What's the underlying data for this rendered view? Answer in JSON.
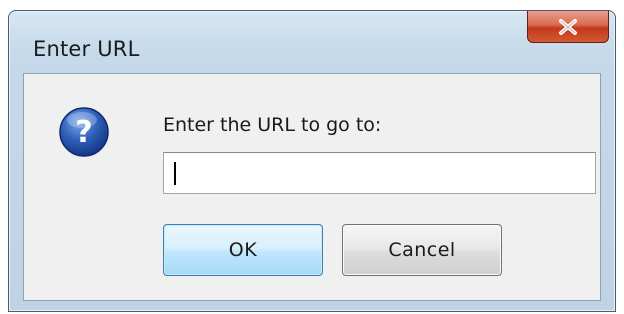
{
  "dialog": {
    "title": "Enter URL",
    "prompt": "Enter the URL to go to:",
    "url_value": "",
    "ok_label": "OK",
    "cancel_label": "Cancel"
  },
  "icons": {
    "close": "close-icon",
    "question": "question-icon"
  },
  "colors": {
    "close_button": "#c2391a",
    "question_icon": "#1e4fa8",
    "ok_button_border": "#3c7fb1"
  }
}
